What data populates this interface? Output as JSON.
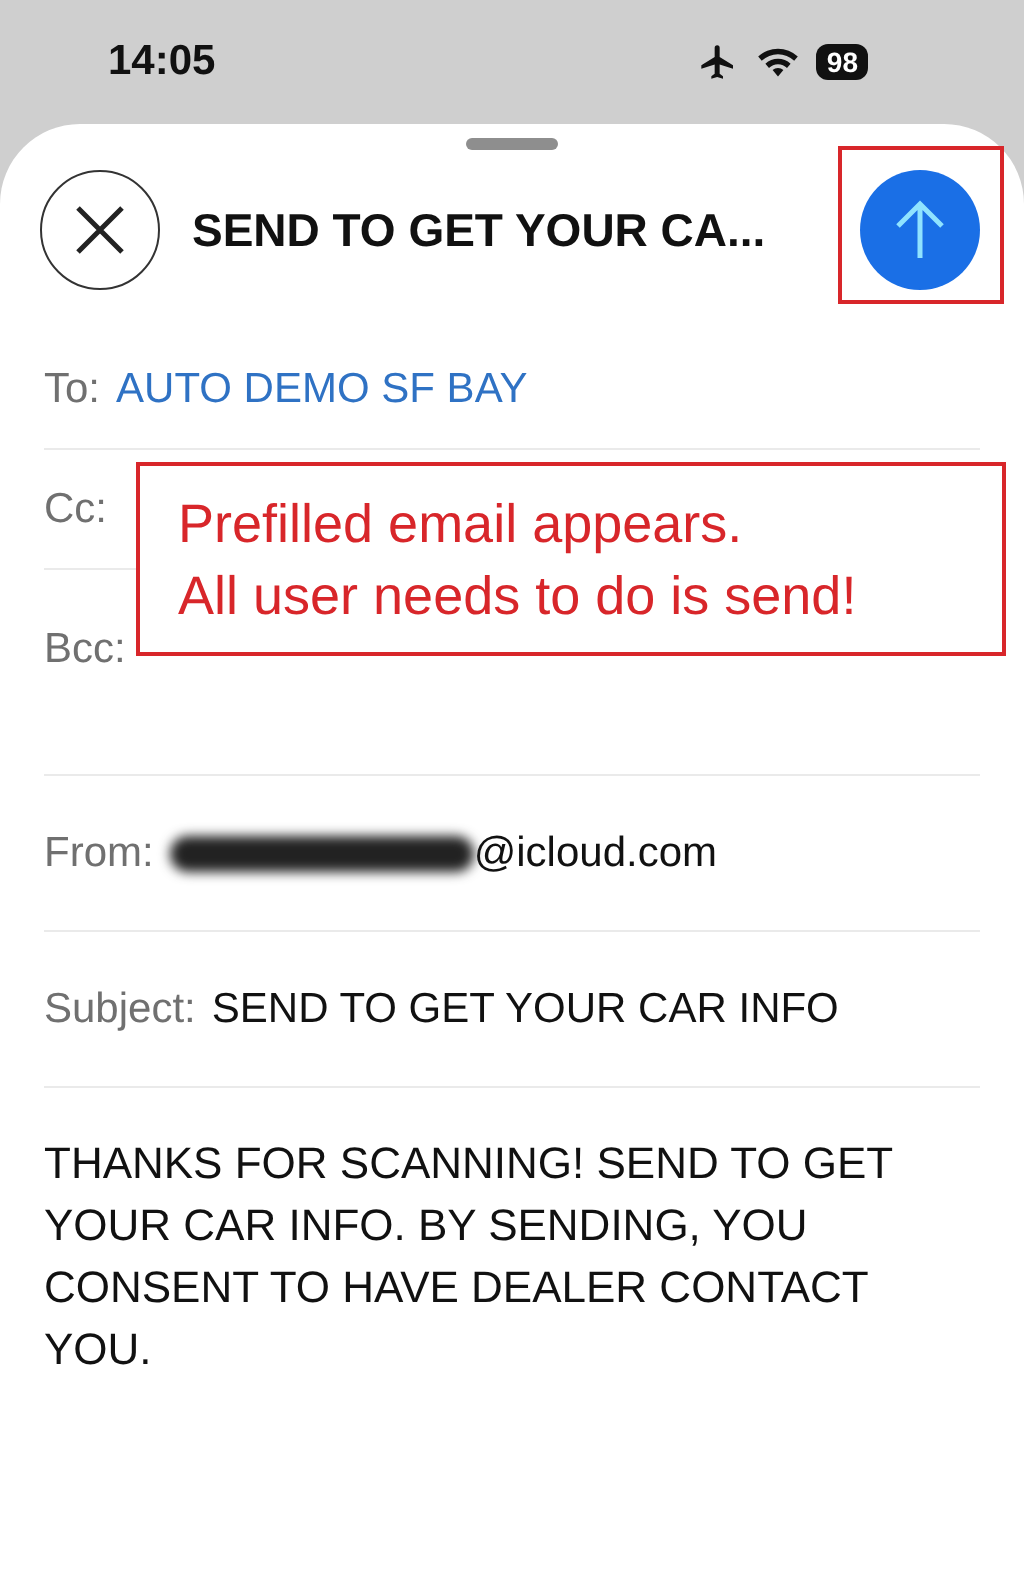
{
  "status_bar": {
    "time": "14:05",
    "battery": "98",
    "airplane_mode": true
  },
  "compose": {
    "title": "SEND TO GET YOUR CA...",
    "fields": [
      {
        "label": "To:",
        "value": "AUTO DEMO SF BAY",
        "kind": "recipient"
      },
      {
        "label": "Cc:",
        "kind": "empty"
      },
      {
        "label": "Bcc:",
        "kind": "empty"
      },
      {
        "label": "From:",
        "value": "@icloud.com",
        "kind": "redacted"
      },
      {
        "label": "Subject:",
        "value": "SEND TO GET YOUR CAR INFO",
        "kind": "plain"
      }
    ],
    "body": "THANKS FOR SCANNING! SEND TO GET YOUR CAR INFO. BY SENDING, YOU CONSENT TO HAVE DEALER CONTACT YOU."
  },
  "annotation": {
    "lines": [
      "Prefilled email appears.",
      "All user needs to do is send!"
    ],
    "highlights_send_button": true
  }
}
